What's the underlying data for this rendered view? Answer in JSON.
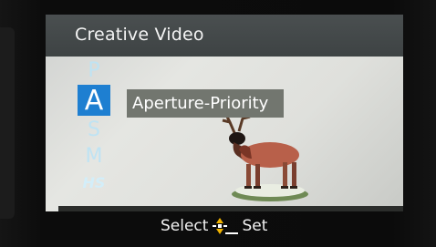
{
  "menu": {
    "title": "Creative Video",
    "modes": [
      {
        "letter": "P",
        "selected": false
      },
      {
        "letter": "A",
        "selected": true
      },
      {
        "letter": "S",
        "selected": false
      },
      {
        "letter": "M",
        "selected": false
      },
      {
        "letter": "HS",
        "selected": false
      }
    ],
    "selected_description": "Aperture-Priority"
  },
  "footer": {
    "select_label": "Select",
    "set_label": "Set"
  },
  "icons": {
    "dpad": "dpad-up-down-icon",
    "set_button": "set-button-icon"
  },
  "colors": {
    "selected_mode_bg": "#1e7fd1",
    "unselected_mode_text": "#bfe3f3",
    "description_bg": "#72766f",
    "title_bar_bg": "#45494a",
    "dpad_accent": "#f2b400"
  }
}
